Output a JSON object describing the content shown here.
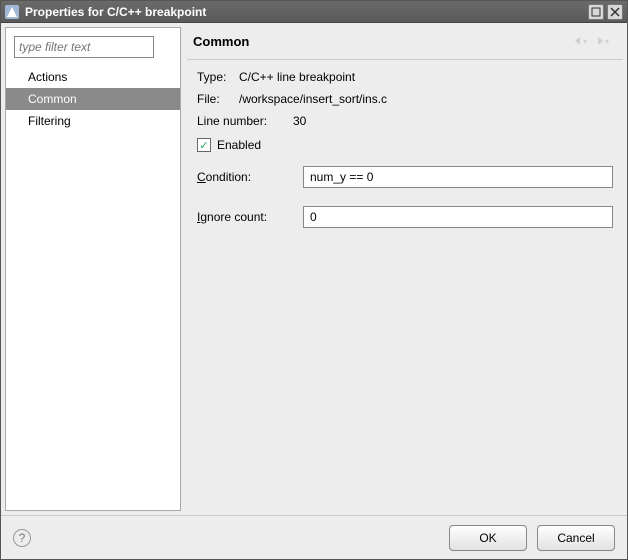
{
  "window": {
    "title": "Properties for C/C++ breakpoint"
  },
  "filter": {
    "placeholder": "type filter text"
  },
  "sidebar": {
    "items": [
      {
        "label": "Actions",
        "selected": false
      },
      {
        "label": "Common",
        "selected": true
      },
      {
        "label": "Filtering",
        "selected": false
      }
    ]
  },
  "content": {
    "title": "Common"
  },
  "info": {
    "type_label": "Type:",
    "type_value": "C/C++ line breakpoint",
    "file_label": "File:",
    "file_value": "/workspace/insert_sort/ins.c",
    "line_label": "Line number:",
    "line_value": "30"
  },
  "enabled": {
    "label": "Enabled",
    "checked": true
  },
  "condition": {
    "label_pre": "C",
    "label_post": "ondition:",
    "value": "num_y == 0"
  },
  "ignore": {
    "label_pre": "I",
    "label_post": "gnore count:",
    "value": "0"
  },
  "buttons": {
    "ok": "OK",
    "cancel": "Cancel"
  }
}
